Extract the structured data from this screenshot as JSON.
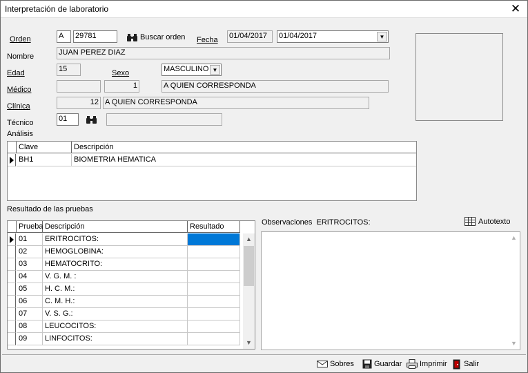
{
  "window": {
    "title": "Interpretación de laboratorio",
    "close_glyph": "✕"
  },
  "form": {
    "orden_label": "Orden",
    "orden_serie": "A",
    "orden_num": "29781",
    "buscar_label": "Buscar orden",
    "fecha_label": "Fecha",
    "fecha_value": "01/04/2017",
    "fecha_select": "01/04/2017",
    "nombre_label": "Nombre",
    "nombre_value": "JUAN PEREZ DIAZ",
    "edad_label": "Edad",
    "edad_value": "15",
    "sexo_label": "Sexo",
    "sexo_value": "MASCULINO",
    "medico_label": "Médico",
    "medico_code1": "",
    "medico_code2": "1",
    "medico_name": "A QUIEN CORRESPONDA",
    "clinica_label": "Clínica",
    "clinica_code": "12",
    "clinica_name": "A QUIEN CORRESPONDA",
    "tecnico_label": "Técnico",
    "tecnico_code": "01",
    "tecnico_name": "",
    "analisis_label": "Análisis"
  },
  "analisis_grid": {
    "columns": [
      "Clave",
      "Descripción"
    ],
    "rows": [
      [
        "BH1",
        "BIOMETRIA HEMATICA"
      ]
    ]
  },
  "resultados": {
    "label": "Resultado de las pruebas",
    "columns": [
      "Prueba",
      "Descripción",
      "Resultado"
    ],
    "rows": [
      [
        "01",
        "ERITROCITOS:",
        ""
      ],
      [
        "02",
        "HEMOGLOBINA:",
        ""
      ],
      [
        "03",
        "HEMATOCRITO:",
        ""
      ],
      [
        "04",
        "V. G. M. :",
        ""
      ],
      [
        "05",
        "H. C. M.:",
        ""
      ],
      [
        "06",
        "C. M. H.:",
        ""
      ],
      [
        "07",
        "V. S. G.:",
        ""
      ],
      [
        "08",
        "LEUCOCITOS:",
        ""
      ],
      [
        "09",
        "LINFOCITOS:",
        ""
      ]
    ]
  },
  "observaciones": {
    "label": "Observaciones",
    "test": "ERITROCITOS:",
    "autotexto_label": "Autotexto",
    "text": ""
  },
  "toolbar": {
    "sobres_label": "Sobres",
    "guardar_label": "Guardar",
    "imprimir_label": "Imprimir",
    "salir_label": "Salir"
  },
  "colors": {
    "selection": "#0078d7",
    "window_bg": "#f0f0f0",
    "exit_red": "#c00000"
  }
}
